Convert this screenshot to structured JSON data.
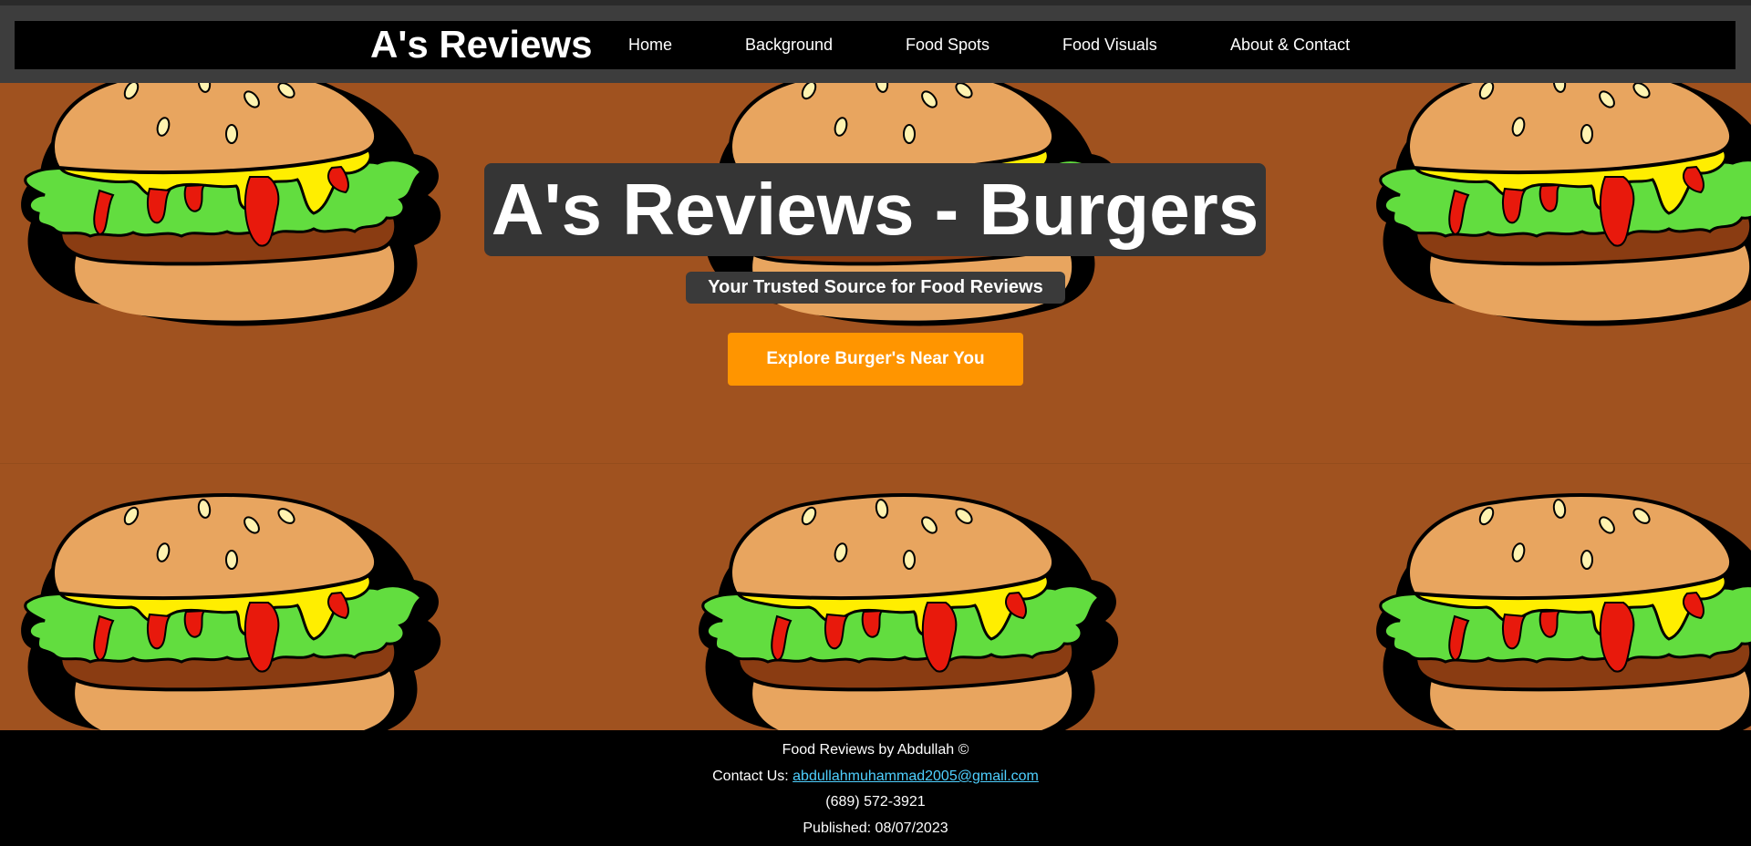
{
  "nav": {
    "brand": "A's Reviews",
    "links": [
      "Home",
      "Background",
      "Food Spots",
      "Food Visuals",
      "About & Contact"
    ]
  },
  "hero": {
    "title": "A's Reviews - Burgers",
    "subtitle": "Your Trusted Source for Food Reviews",
    "cta_label": "Explore Burger's Near You",
    "background_image": "burger-pattern"
  },
  "footer": {
    "credit": "Food Reviews by Abdullah ©",
    "contact_prefix": "Contact Us: ",
    "email": "abdullahmuhammad2005@gmail.com",
    "phone": "(689) 572-3921",
    "published": "Published: 08/07/2023"
  },
  "colors": {
    "hero_background": "#a0521f",
    "cta": "#ff9500",
    "nav_background": "#000000",
    "link": "#4fd0ff"
  }
}
